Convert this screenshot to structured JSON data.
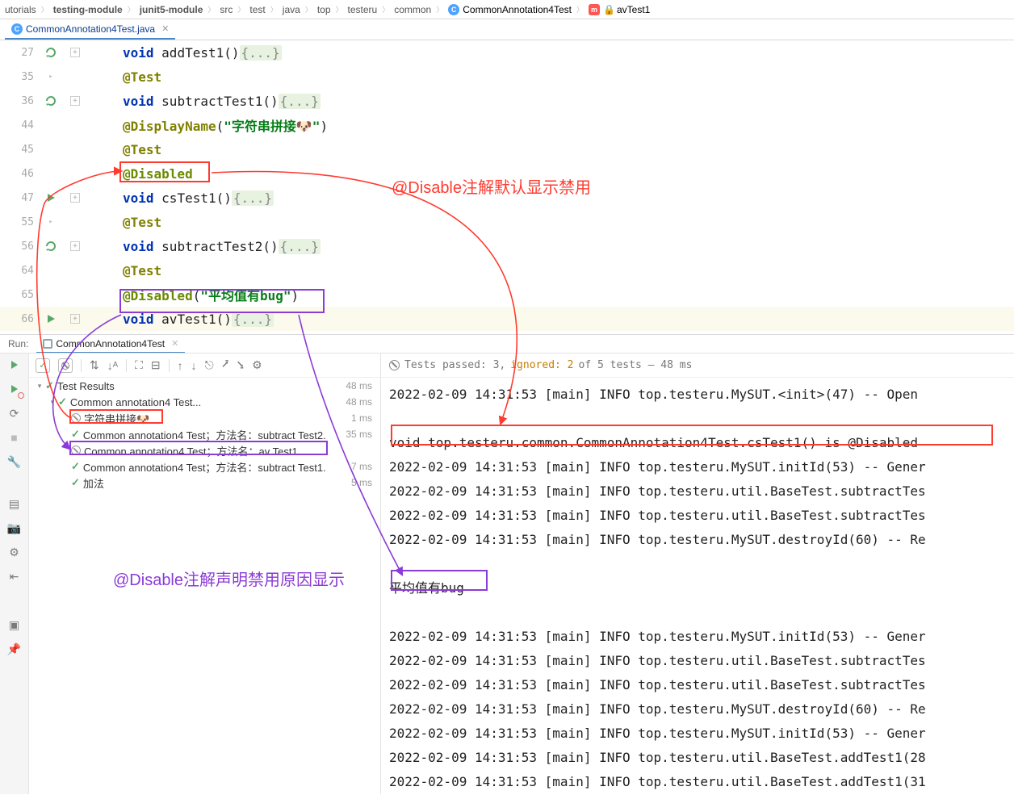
{
  "breadcrumb": {
    "items": [
      "utorials",
      "testing-module",
      "junit5-module",
      "src",
      "test",
      "java",
      "top",
      "testeru",
      "common"
    ],
    "class_name": "CommonAnnotation4Test",
    "method_name": "avTest1"
  },
  "tab": {
    "file": "CommonAnnotation4Test.java"
  },
  "editor": {
    "lines": [
      {
        "n": "27",
        "gutter": "cycle",
        "fold": "+",
        "t": [
          {
            "k": "kw",
            "v": "void "
          },
          {
            "k": "plain",
            "v": "addTest1()"
          },
          {
            "k": "fold",
            "v": "{...}"
          }
        ]
      },
      {
        "n": "35",
        "gutter": "chev",
        "t": [
          {
            "k": "ann",
            "v": "@Test"
          }
        ]
      },
      {
        "n": "36",
        "gutter": "cycle",
        "fold": "+",
        "t": [
          {
            "k": "kw",
            "v": "void "
          },
          {
            "k": "plain",
            "v": "subtractTest1()"
          },
          {
            "k": "fold",
            "v": "{...}"
          }
        ]
      },
      {
        "n": "44",
        "t": [
          {
            "k": "ann",
            "v": "@DisplayName"
          },
          {
            "k": "plain",
            "v": "("
          },
          {
            "k": "str",
            "v": "\"字符串拼接🐶\""
          },
          {
            "k": "plain",
            "v": ")"
          }
        ]
      },
      {
        "n": "45",
        "t": [
          {
            "k": "ann",
            "v": "@Test"
          }
        ]
      },
      {
        "n": "46",
        "t": [
          {
            "k": "ann2",
            "v": "@Disabled"
          }
        ]
      },
      {
        "n": "47",
        "gutter": "play",
        "fold": "+",
        "t": [
          {
            "k": "kw",
            "v": "void "
          },
          {
            "k": "plain",
            "v": "csTest1()"
          },
          {
            "k": "fold",
            "v": "{...}"
          }
        ]
      },
      {
        "n": "55",
        "gutter": "chev",
        "t": [
          {
            "k": "ann",
            "v": "@Test"
          }
        ]
      },
      {
        "n": "56",
        "gutter": "cycle",
        "fold": "+",
        "t": [
          {
            "k": "kw",
            "v": "void "
          },
          {
            "k": "plain",
            "v": "subtractTest2()"
          },
          {
            "k": "fold",
            "v": "{...}"
          }
        ]
      },
      {
        "n": "64",
        "t": [
          {
            "k": "ann",
            "v": "@Test"
          }
        ]
      },
      {
        "n": "65",
        "t": [
          {
            "k": "ann2",
            "v": "@Disabled"
          },
          {
            "k": "plain",
            "v": "("
          },
          {
            "k": "str",
            "v": "\"平均值有bug\""
          },
          {
            "k": "plain",
            "v": ")"
          }
        ]
      },
      {
        "n": "66",
        "gutter": "play",
        "fold": "+",
        "caret": true,
        "t": [
          {
            "k": "kw",
            "v": "void "
          },
          {
            "k": "plain",
            "v": "avTest1()"
          },
          {
            "k": "fold",
            "v": "{...}"
          }
        ]
      }
    ]
  },
  "run": {
    "label": "Run:",
    "tab": "CommonAnnotation4Test"
  },
  "status": {
    "pre": "Tests passed: 3, ",
    "ignored": "ignored: 2",
    "post": " of 5 tests – 48 ms"
  },
  "tree": {
    "root": {
      "name": "Test Results",
      "time": "48 ms"
    },
    "suite": {
      "name": "Common annotation4 Test...",
      "time": "48 ms"
    },
    "items": [
      {
        "icon": "dis",
        "name": "字符串拼接🐶",
        "time": "1 ms"
      },
      {
        "icon": "ok",
        "name": "Common annotation4 Test；方法名：subtract Test2.",
        "time": "35 ms"
      },
      {
        "icon": "dis",
        "name": "Common annotation4 Test；方法名：av Test1.",
        "time": ""
      },
      {
        "icon": "ok",
        "name": "Common annotation4 Test；方法名：subtract Test1.",
        "time": "7 ms"
      },
      {
        "icon": "ok",
        "name": "加法",
        "time": "5 ms"
      }
    ]
  },
  "console": {
    "lines": [
      "2022-02-09 14:31:53 [main] INFO  top.testeru.MySUT.<init>(47) -- Open",
      "",
      "void top.testeru.common.CommonAnnotation4Test.csTest1() is @Disabled",
      "2022-02-09 14:31:53 [main] INFO  top.testeru.MySUT.initId(53) -- Gener",
      "2022-02-09 14:31:53 [main] INFO  top.testeru.util.BaseTest.subtractTes",
      "2022-02-09 14:31:53 [main] INFO  top.testeru.util.BaseTest.subtractTes",
      "2022-02-09 14:31:53 [main] INFO  top.testeru.MySUT.destroyId(60) -- Re",
      "",
      "平均值有bug",
      "",
      "2022-02-09 14:31:53 [main] INFO  top.testeru.MySUT.initId(53) -- Gener",
      "2022-02-09 14:31:53 [main] INFO  top.testeru.util.BaseTest.subtractTes",
      "2022-02-09 14:31:53 [main] INFO  top.testeru.util.BaseTest.subtractTes",
      "2022-02-09 14:31:53 [main] INFO  top.testeru.MySUT.destroyId(60) -- Re",
      "2022-02-09 14:31:53 [main] INFO  top.testeru.MySUT.initId(53) -- Gener",
      "2022-02-09 14:31:53 [main] INFO  top.testeru.util.BaseTest.addTest1(28",
      "2022-02-09 14:31:53 [main] INFO  top.testeru.util.BaseTest.addTest1(31"
    ]
  },
  "annotations": {
    "red_text": "@Disable注解默认显示禁用",
    "purple_text": "@Disable注解声明禁用原因显示"
  }
}
